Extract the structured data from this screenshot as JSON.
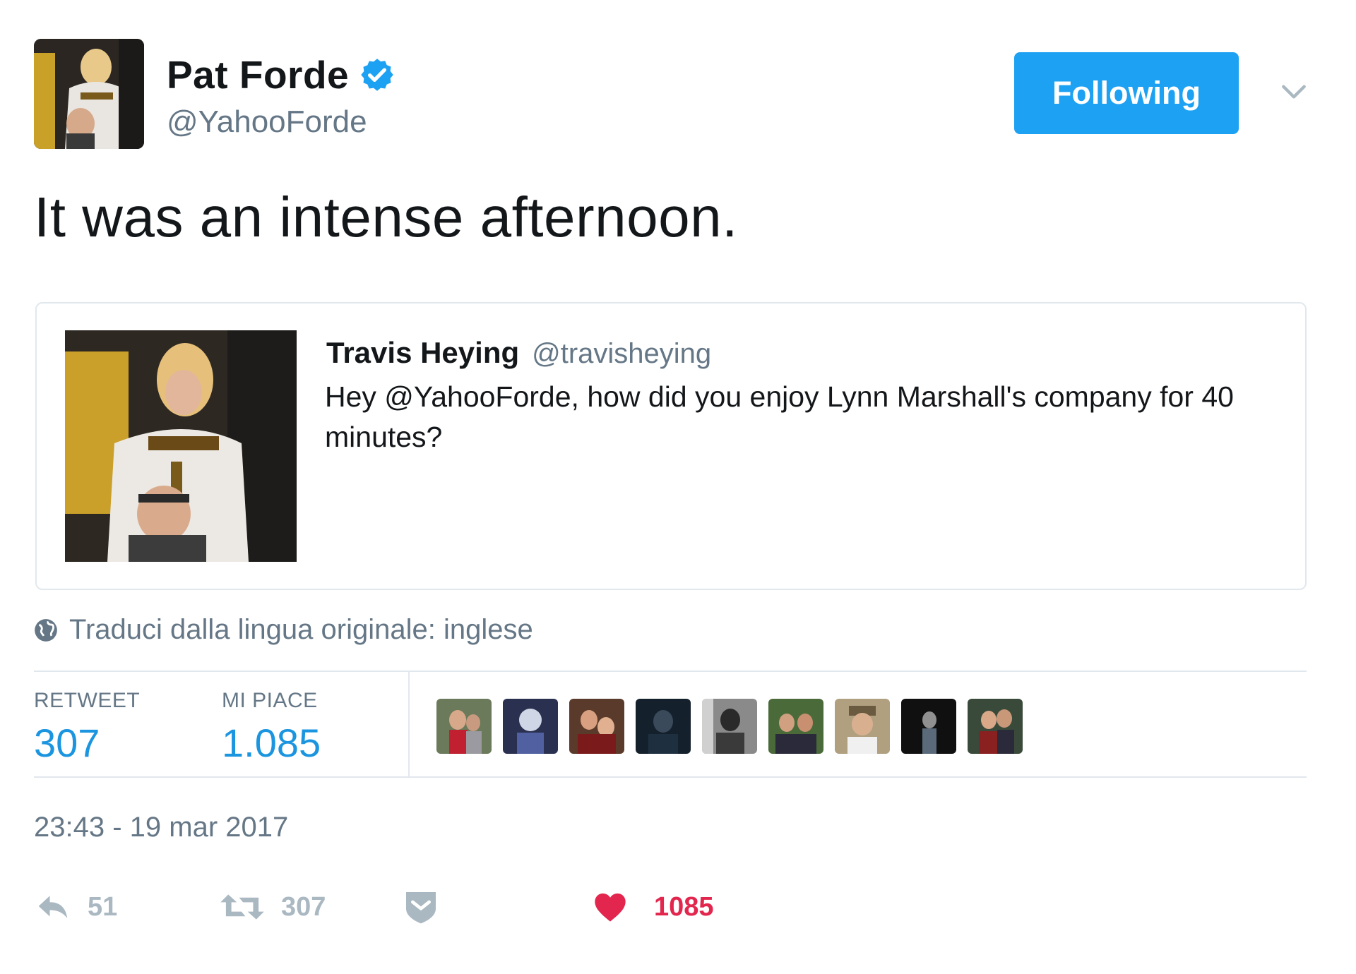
{
  "author": {
    "name": "Pat Forde",
    "handle": "@YahooForde",
    "avatar_icon": "person-photo-icon",
    "verified_icon": "verified-badge-icon"
  },
  "follow_button": {
    "label": "Following"
  },
  "menu_icon": "chevron-down-icon",
  "tweet": {
    "text": "It was an intense afternoon."
  },
  "quoted_tweet": {
    "name": "Travis Heying",
    "handle": "@travisheying",
    "text": "Hey @YahooForde, how did you enjoy Lynn Marshall's company for 40 minutes?",
    "image_icon": "photo-thumbnail-icon"
  },
  "translate": {
    "icon": "globe-icon",
    "label": "Traduci dalla lingua originale: inglese"
  },
  "stats": {
    "retweet_label": "RETWEET",
    "retweet_value": "307",
    "likes_label": "MI PIACE",
    "likes_value": "1.085",
    "liker_count": 9
  },
  "timestamp": "23:43 - 19 mar 2017",
  "actions": {
    "reply": {
      "icon": "reply-icon",
      "count": "51"
    },
    "retweet": {
      "icon": "retweet-icon",
      "count": "307"
    },
    "dm": {
      "icon": "direct-message-icon"
    },
    "like": {
      "icon": "heart-icon",
      "count": "1085"
    }
  },
  "colors": {
    "accent": "#1da1f2",
    "link": "#1b95e0",
    "secondary_text": "#657786",
    "like": "#e2264d",
    "border": "#e1e8ed"
  }
}
